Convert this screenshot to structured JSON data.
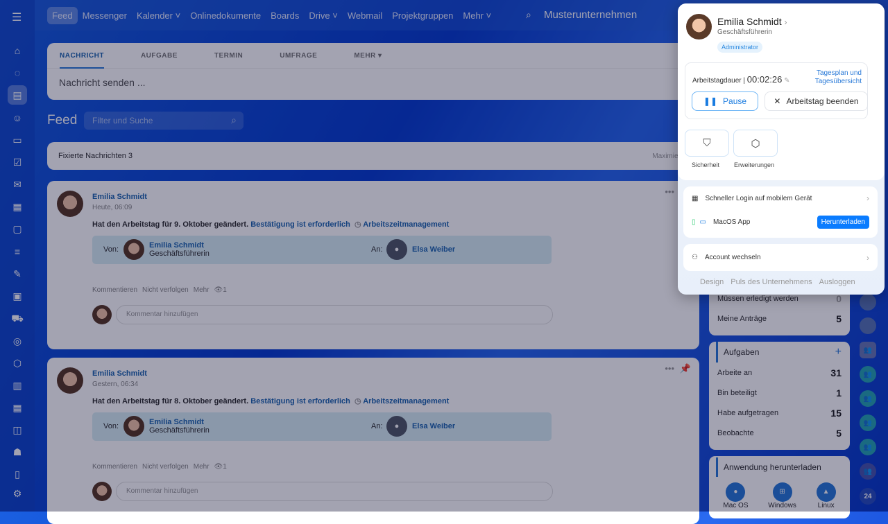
{
  "nav": {
    "items": [
      "Feed",
      "Messenger",
      "Kalender",
      "Onlinedokumente",
      "Boards",
      "Drive",
      "Webmail",
      "Projektgruppen",
      "Mehr"
    ],
    "company": "Musterunternehmen"
  },
  "composer": {
    "tabs": [
      "NACHRICHT",
      "AUFGABE",
      "TERMIN",
      "UMFRAGE",
      "MEHR"
    ],
    "placeholder": "Nachricht senden ..."
  },
  "feed": {
    "title": "Feed",
    "filter_placeholder": "Filter und Suche",
    "pinned_label": "Fixierte Nachrichten",
    "pinned_count": "3",
    "maximize": "Maximieren"
  },
  "posts": [
    {
      "author": "Emilia Schmidt",
      "time": "Heute, 06:09",
      "text": "Hat den Arbeitstag für 9. Oktober geändert.",
      "confirm": "Bestätigung ist erforderlich",
      "module": "Arbeitszeitmanagement",
      "from_label": "Von:",
      "from_name": "Emilia Schmidt",
      "from_role": "Geschäftsführerin",
      "to_label": "An:",
      "to_name": "Elsa Weiber",
      "actions": [
        "Kommentieren",
        "Nicht verfolgen",
        "Mehr"
      ],
      "views": "1",
      "comment_placeholder": "Kommentar hinzufügen"
    },
    {
      "author": "Emilia Schmidt",
      "time": "Gestern, 06:34",
      "text": "Hat den Arbeitstag für 8. Oktober geändert.",
      "confirm": "Bestätigung ist erforderlich",
      "module": "Arbeitszeitmanagement",
      "from_label": "Von:",
      "from_name": "Emilia Schmidt",
      "from_role": "Geschäftsführerin",
      "to_label": "An:",
      "to_name": "Elsa Weiber",
      "actions": [
        "Kommentieren",
        "Nicht verfolgen",
        "Mehr"
      ],
      "views": "1",
      "comment_placeholder": "Kommentar hinzufügen"
    }
  ],
  "widgets": {
    "requests": [
      {
        "label": "Müssen erledigt werden",
        "value": "0"
      },
      {
        "label": "Meine Anträge",
        "value": "5"
      }
    ],
    "tasks": {
      "title": "Aufgaben",
      "rows": [
        {
          "label": "Arbeite an",
          "value": "31"
        },
        {
          "label": "Bin beteiligt",
          "value": "1"
        },
        {
          "label": "Habe aufgetragen",
          "value": "15"
        },
        {
          "label": "Beobachte",
          "value": "5"
        }
      ]
    },
    "download": {
      "title": "Anwendung herunterladen",
      "apps": [
        "Mac OS",
        "Windows",
        "Linux"
      ]
    }
  },
  "right_badge": "24",
  "popup": {
    "name": "Emilia Schmidt",
    "role": "Geschäftsführerin",
    "badge": "Administrator",
    "workday_label": "Arbeitstagdauer |",
    "workday_time": "00:02:26",
    "dayplan_link": "Tagesplan und Tagesübersicht",
    "pause": "Pause",
    "end_day": "Arbeitstag beenden",
    "tiles": [
      "Sicherheit",
      "Erweiterungen"
    ],
    "quick_login": "Schneller Login auf mobilem Gerät",
    "macos_app": "MacOS App",
    "download": "Herunterladen",
    "switch_account": "Account wechseln",
    "footer": [
      "Design",
      "Puls des Unternehmens",
      "Ausloggen"
    ]
  },
  "colors": {
    "accent": "#2b7bd8",
    "link": "#2067b0",
    "download_button": "#0a7cff"
  }
}
